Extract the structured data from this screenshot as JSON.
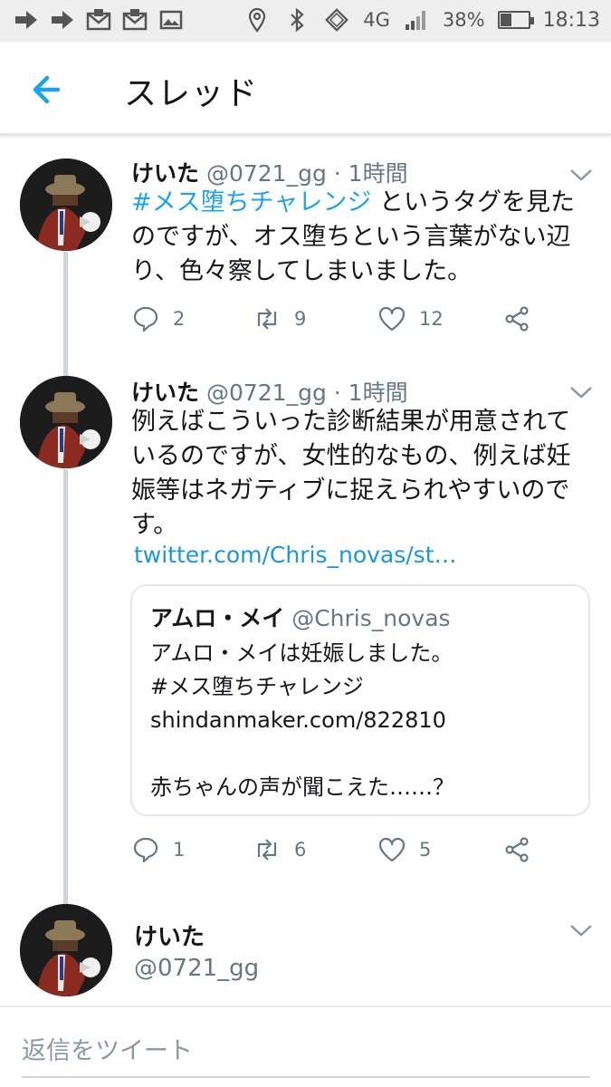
{
  "status_bar": {
    "network": "4G",
    "battery": "38%",
    "battery_level": 0.38,
    "time": "18:13"
  },
  "header": {
    "title": "スレッド"
  },
  "tweets": [
    {
      "name": "けいた",
      "meta": "@0721_gg · 1時間",
      "text_hashtag": "#メス堕ちチャレンジ",
      "text_rest": " というタグを見たのですが、オス堕ちという言葉がない辺り、色々察してしまいました。",
      "replies": "2",
      "retweets": "9",
      "likes": "12"
    },
    {
      "name": "けいた",
      "meta": "@0721_gg · 1時間",
      "text": "例えばこういった診断結果が用意されているのですが、女性的なもの、例えば妊娠等はネガティブに捉えられやすいのです。",
      "link": "twitter.com/Chris_novas/st…",
      "quote": {
        "name": "アムロ・メイ",
        "handle": "@Chris_novas",
        "line1": "アムロ・メイは妊娠しました。",
        "line2": "#メス堕ちチャレンジ",
        "line3": "shindanmaker.com/822810",
        "line4": "赤ちゃんの声が聞こえた……？"
      },
      "replies": "1",
      "retweets": "6",
      "likes": "5"
    }
  ],
  "reply_author": {
    "name": "けいた",
    "handle": "@0721_gg"
  },
  "reply_box": {
    "placeholder": "返信をツイート"
  },
  "colors": {
    "accent": "#1da1f2",
    "muted": "#657786",
    "thread_line": "#ccd6dd"
  }
}
